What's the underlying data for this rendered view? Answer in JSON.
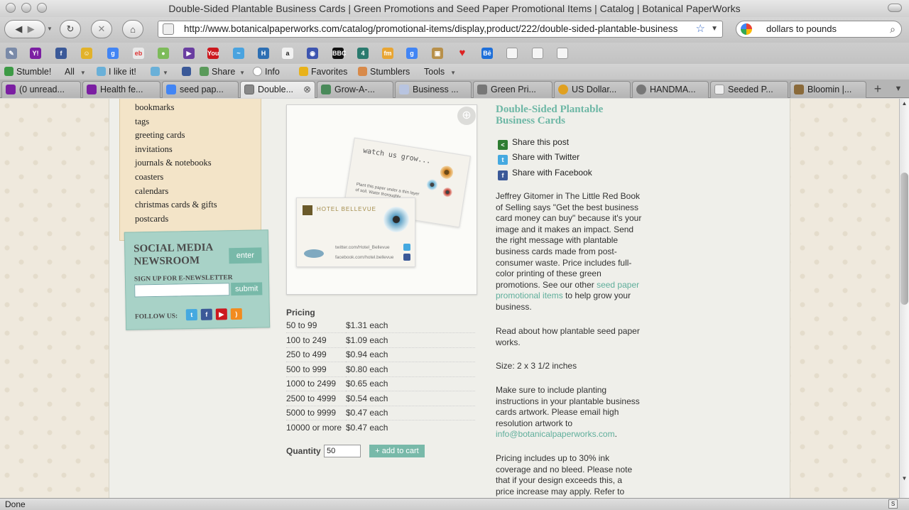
{
  "window": {
    "title": "Double-Sided Plantable Business Cards | Green Promotions and Seed Paper Promotional Items | Catalog | Botanical PaperWorks"
  },
  "navbar": {
    "url": "http://www.botanicalpaperworks.com/catalog/promotional-items/display,product/222/double-sided-plantable-business",
    "search_value": "dollars to pounds"
  },
  "bookmarks_toolbar": {
    "icons": [
      "pencil-icon",
      "yahoo-icon",
      "facebook-icon",
      "smiley-icon",
      "google-icon",
      "ebay-icon",
      "frog-icon",
      "play-icon",
      "youtube-icon",
      "wave-icon",
      "h-icon",
      "amazon-icon",
      "circle-icon",
      "bbc-icon",
      "channel4-icon",
      "fm-icon",
      "google-icon",
      "box-icon",
      "heart-icon",
      "behance-icon",
      "page-icon",
      "page-icon",
      "page-icon"
    ]
  },
  "stumble_toolbar": {
    "stumble": "Stumble!",
    "all": "All",
    "like": "I like it!",
    "share": "Share",
    "info": "Info",
    "favorites": "Favorites",
    "stumblers": "Stumblers",
    "tools": "Tools"
  },
  "tabs": [
    {
      "label": "(0 unread...",
      "icon_color": "#7b1fa2"
    },
    {
      "label": "Health fe...",
      "icon_color": "#7b1fa2"
    },
    {
      "label": "seed pap...",
      "icon_color": "#4285f4"
    },
    {
      "label": "Double...",
      "icon_color": "#888888"
    },
    {
      "label": "Grow-A-...",
      "icon_color": "#4a8a5a"
    },
    {
      "label": "Business ...",
      "icon_color": "#b8c4e0"
    },
    {
      "label": "Green Pri...",
      "icon_color": "#777777"
    },
    {
      "label": "US Dollar...",
      "icon_color": "#e0a020"
    },
    {
      "label": "HANDMA...",
      "icon_color": "#777777"
    },
    {
      "label": "Seeded P...",
      "icon_color": "#dddddd"
    },
    {
      "label": "Bloomin |...",
      "icon_color": "#8a6a3a"
    }
  ],
  "sidebar": {
    "items": [
      "bookmarks",
      "tags",
      "greeting cards",
      "invitations",
      "journals & notebooks",
      "coasters",
      "calendars",
      "christmas cards & gifts",
      "postcards"
    ]
  },
  "social": {
    "title_line1": "SOCIAL MEDIA",
    "title_line2": "NEWSROOM",
    "enter": "enter",
    "newsletter_label": "SIGN UP FOR E-NEWSLETTER",
    "submit": "submit",
    "follow_label": "FOLLOW US:"
  },
  "product_image": {
    "back_card_heading": "watch us grow...",
    "back_card_text": "Plant this paper under a thin layer of soil. Water thoroughly...",
    "front_card_name": "HOTEL BELLEVUE",
    "front_card_twitter": "twitter.com/Hotel_Bellevue",
    "front_card_facebook": "facebook.com/hotel.bellevue"
  },
  "pricing": {
    "title": "Pricing",
    "rows": [
      {
        "qty": "50 to 99",
        "price": "$1.31 each"
      },
      {
        "qty": "100 to 249",
        "price": "$1.09 each"
      },
      {
        "qty": "250 to 499",
        "price": "$0.94 each"
      },
      {
        "qty": "500 to 999",
        "price": "$0.80 each"
      },
      {
        "qty": "1000 to 2499",
        "price": "$0.65 each"
      },
      {
        "qty": "2500 to 4999",
        "price": "$0.54 each"
      },
      {
        "qty": "5000 to 9999",
        "price": "$0.47 each"
      },
      {
        "qty": "10000 or more",
        "price": "$0.47 each"
      }
    ],
    "quantity_label": "Quantity",
    "quantity_value": "50",
    "add_to_cart": "+ add to cart"
  },
  "product": {
    "title": "Double-Sided Plantable Business Cards",
    "share_post": "Share this post",
    "share_twitter": "Share with Twitter",
    "share_facebook": "Share with Facebook",
    "desc1": "Jeffrey Gitomer in The Little Red Book of Selling says \"Get the best business card money can buy\" because it's your image and it makes an impact. Send the right message with plantable business cards made from post-consumer waste. Price includes full-color printing of these green promotions. See our other ",
    "desc1_link": "seed paper promotional items",
    "desc1_end": " to help grow your business.",
    "read_link": "Read about how plantable seed paper works.",
    "size": "Size: 2 x 3 1/2 inches",
    "desc3": "Make sure to include planting instructions in your plantable business cards artwork. Please email high resolution artwork to ",
    "email": "info@botanicalpaperworks.com",
    "desc3_end": ".",
    "desc4": "Pricing includes up to 30% ink coverage and no bleed. Please note that if your design exceeds this, a price increase may apply. Refer to"
  },
  "status": {
    "text": "Done"
  }
}
